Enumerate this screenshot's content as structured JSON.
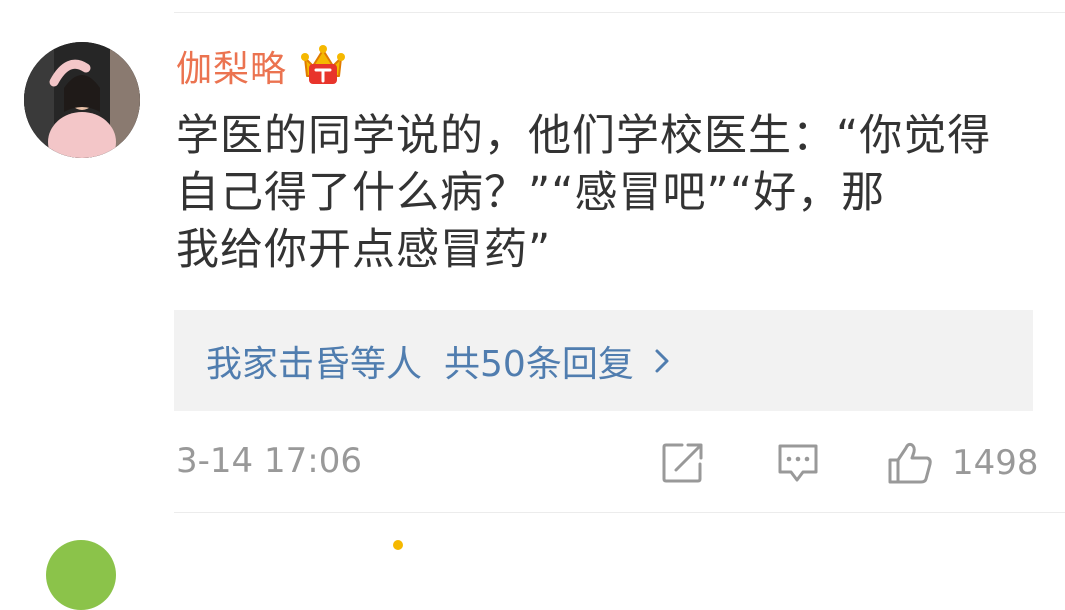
{
  "comment": {
    "username": "伽梨略",
    "badge_icon": "crown-badge-icon",
    "text": "学医的同学说的，他们学校医生：“你觉得\n自己得了什么病？”“感冒吧”“好，那\n我给你开点感冒药”",
    "replies": {
      "names": "我家击昏等人",
      "count_label": "共50条回复"
    },
    "timestamp": "3-14 17:06",
    "actions": {
      "share_icon": "share-icon",
      "comment_icon": "comment-icon",
      "like_icon": "thumbs-up-icon",
      "like_count": "1498"
    }
  },
  "colors": {
    "username": "#eb7350",
    "link": "#507daf",
    "meta": "#999999",
    "text": "#333333",
    "reply_bg": "#f2f2f2"
  }
}
